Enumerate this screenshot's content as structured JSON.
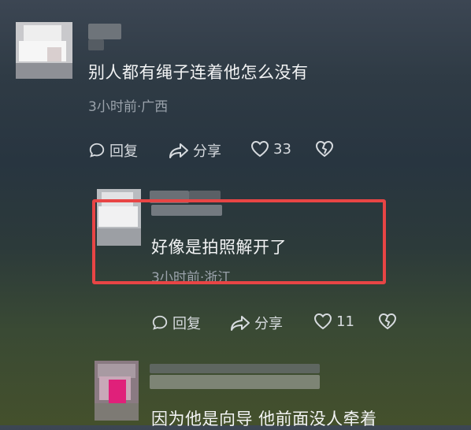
{
  "comments": [
    {
      "text": "别人都有绳子连着他怎么没有",
      "meta": "3小时前·广西",
      "reply_label": "回复",
      "share_label": "分享",
      "like_count": "33"
    },
    {
      "text": "好像是拍照解开了",
      "meta": "3小时前·浙江",
      "reply_label": "回复",
      "share_label": "分享",
      "like_count": "11"
    },
    {
      "text": "因为他是向导 他前面没人牵着"
    }
  ],
  "colors": {
    "highlight_border": "#e84545",
    "text": "#f2f3f4",
    "meta": "#9aa2ab"
  },
  "icons": [
    "comment-icon",
    "share-icon",
    "heart-icon",
    "broken-heart-icon"
  ]
}
